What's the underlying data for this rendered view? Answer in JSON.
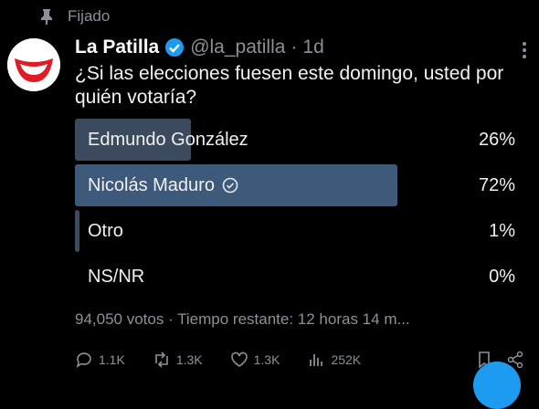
{
  "pinned": {
    "label": "Fijado"
  },
  "author": {
    "name": "La Patilla",
    "handle": "@la_patilla",
    "separator": "·",
    "time": "1d"
  },
  "tweet": {
    "text": "¿Si las elecciones fuesen este domingo, usted por quién votaría?"
  },
  "poll": {
    "options": [
      {
        "label": "Edmundo González",
        "percent": "26%",
        "value": 26
      },
      {
        "label": "Nicolás Maduro",
        "percent": "72%",
        "value": 72,
        "selected": true
      },
      {
        "label": "Otro",
        "percent": "1%",
        "value": 1
      },
      {
        "label": "NS/NR",
        "percent": "0%",
        "value": 0
      }
    ],
    "meta": "94,050 votos · Tiempo restante: 12 horas 14 m..."
  },
  "actions": {
    "replies": "1.1K",
    "reposts": "1.3K",
    "likes": "1.3K",
    "views": "252K"
  },
  "colors": {
    "background": "#000000",
    "bar": "#3b4a5d",
    "bar_leader": "#3e5a7b",
    "verified": "#1d9bf0",
    "muted": "#8b9198"
  },
  "icons": {
    "pin": "pin-icon",
    "verified": "verified-icon",
    "reply": "reply-icon",
    "repost": "repost-icon",
    "like": "heart-icon",
    "views": "bar-chart-icon",
    "bookmark": "bookmark-icon",
    "share": "share-icon",
    "more": "more-icon"
  }
}
